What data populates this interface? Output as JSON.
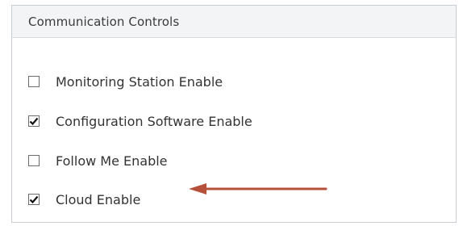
{
  "panel": {
    "title": "Communication Controls"
  },
  "options": [
    {
      "label": "Monitoring Station Enable",
      "checked": false
    },
    {
      "label": "Configuration Software Enable",
      "checked": true
    },
    {
      "label": "Follow Me Enable",
      "checked": false
    },
    {
      "label": "Cloud Enable",
      "checked": true
    }
  ],
  "annotation": {
    "arrow_color": "#b5503a"
  },
  "icons": {
    "checkmark": "checkmark-icon",
    "arrow": "arrow-left-icon"
  }
}
